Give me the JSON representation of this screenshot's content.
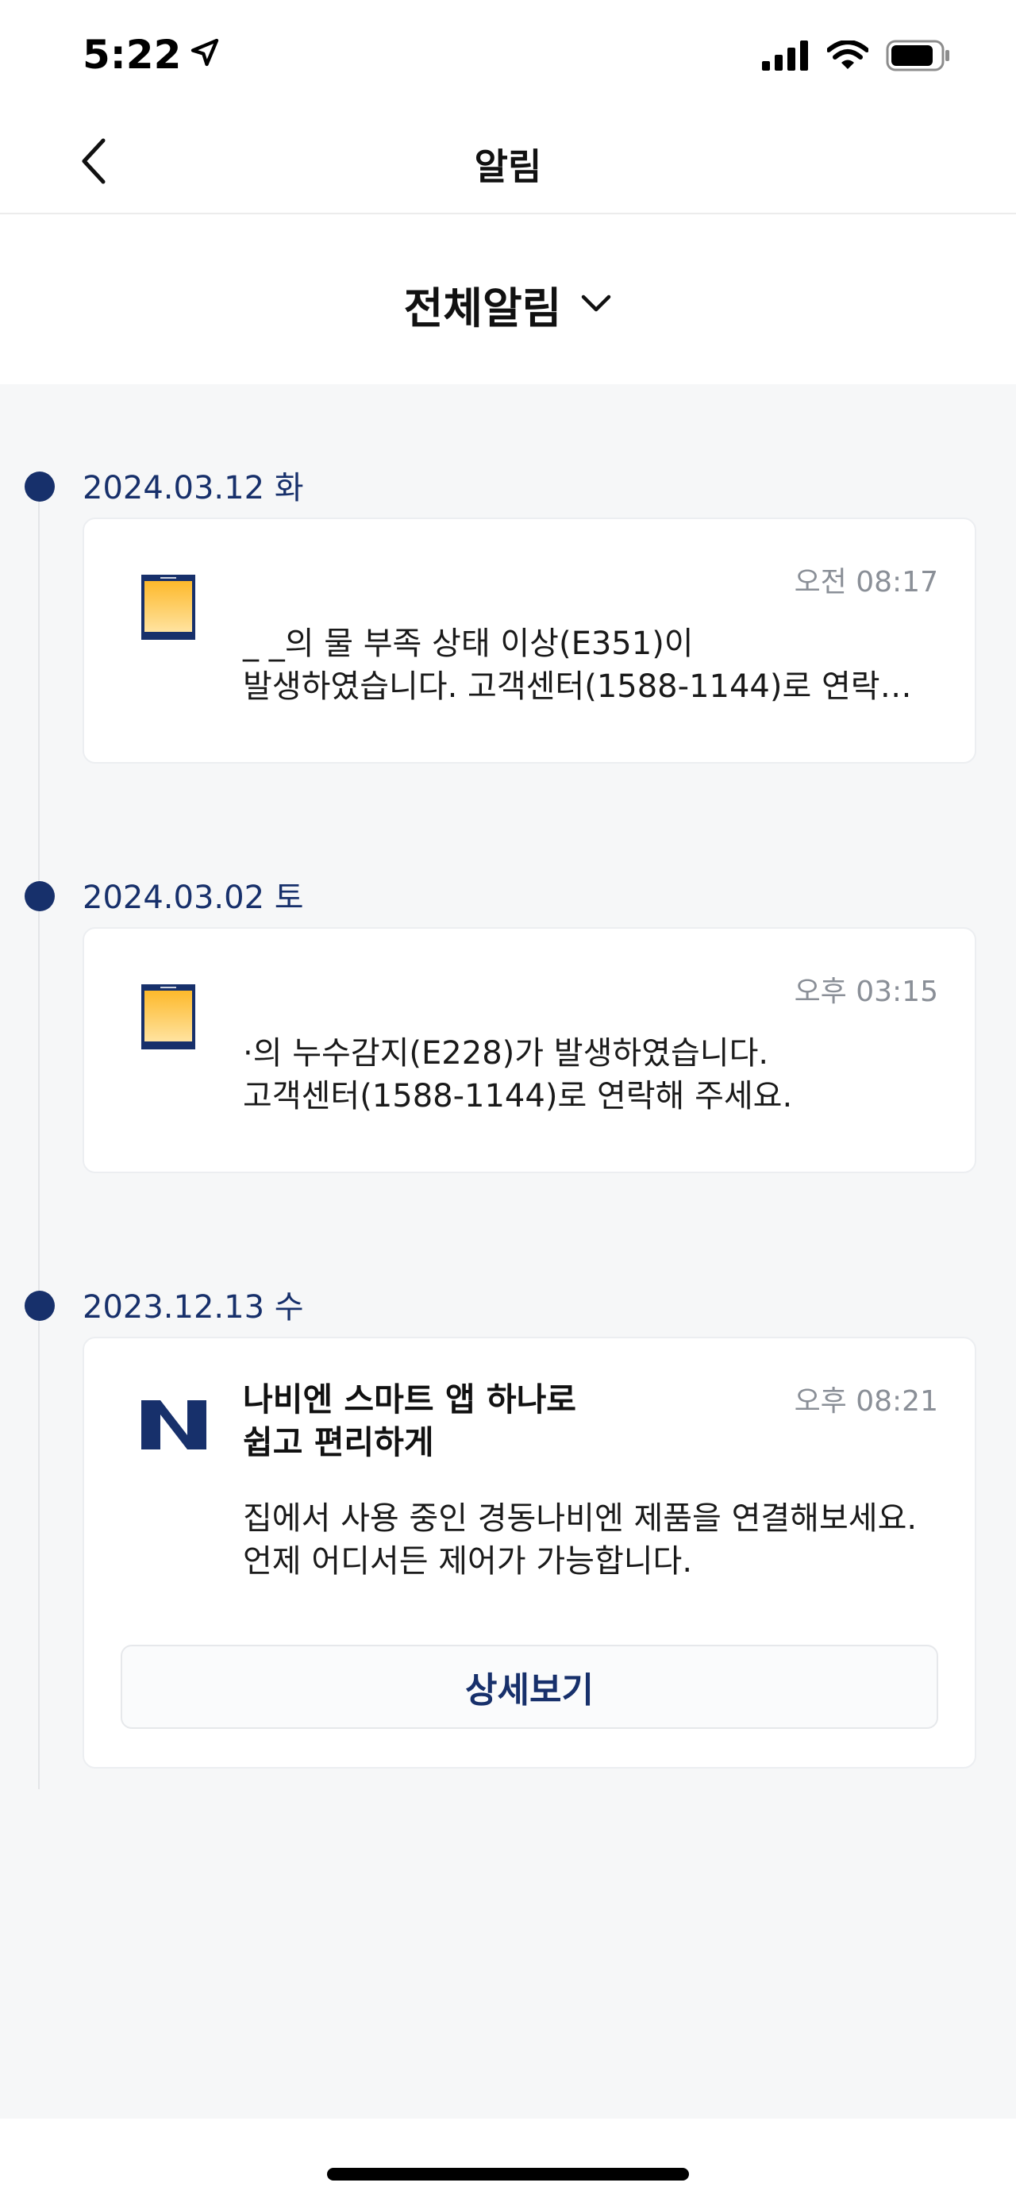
{
  "status_bar": {
    "time": "5:22",
    "icons": [
      "location-arrow-icon",
      "signal-icon",
      "wifi-icon",
      "battery-icon"
    ]
  },
  "nav": {
    "title": "알림",
    "back_icon": "chevron-left-icon"
  },
  "filter": {
    "label": "전체알림",
    "icon": "chevron-down-icon"
  },
  "colors": {
    "accent": "#17306b",
    "background": "#f6f7f8",
    "muted_text": "#8a8f97",
    "device_icon_top": "#fdb92b",
    "device_icon_bottom": "#ffe3a0"
  },
  "groups": [
    {
      "date": "2024.03.12 화",
      "card": {
        "icon": "water-heater-device-icon",
        "time": "오전 08:17",
        "text": "_ _의 물 부족 상태 이상(E351)이\n발생하였습니다. 고객센터(1588-1144)로 연락…"
      }
    },
    {
      "date": "2024.03.02 토",
      "card": {
        "icon": "water-heater-device-icon",
        "time": "오후 03:15",
        "text": "      ·의 누수감지(E228)가 발생하였습니다.\n고객센터(1588-1144)로 연락해 주세요."
      }
    },
    {
      "date": "2023.12.13 수",
      "card": {
        "icon": "navien-logo-icon",
        "time": "오후 08:21",
        "title": "나비엔 스마트 앱 하나로\n쉽고 편리하게",
        "text": "집에서 사용 중인 경동나비엔 제품을 연결해보세요.\n언제 어디서든 제어가 가능합니다.",
        "button_label": "상세보기"
      }
    }
  ]
}
